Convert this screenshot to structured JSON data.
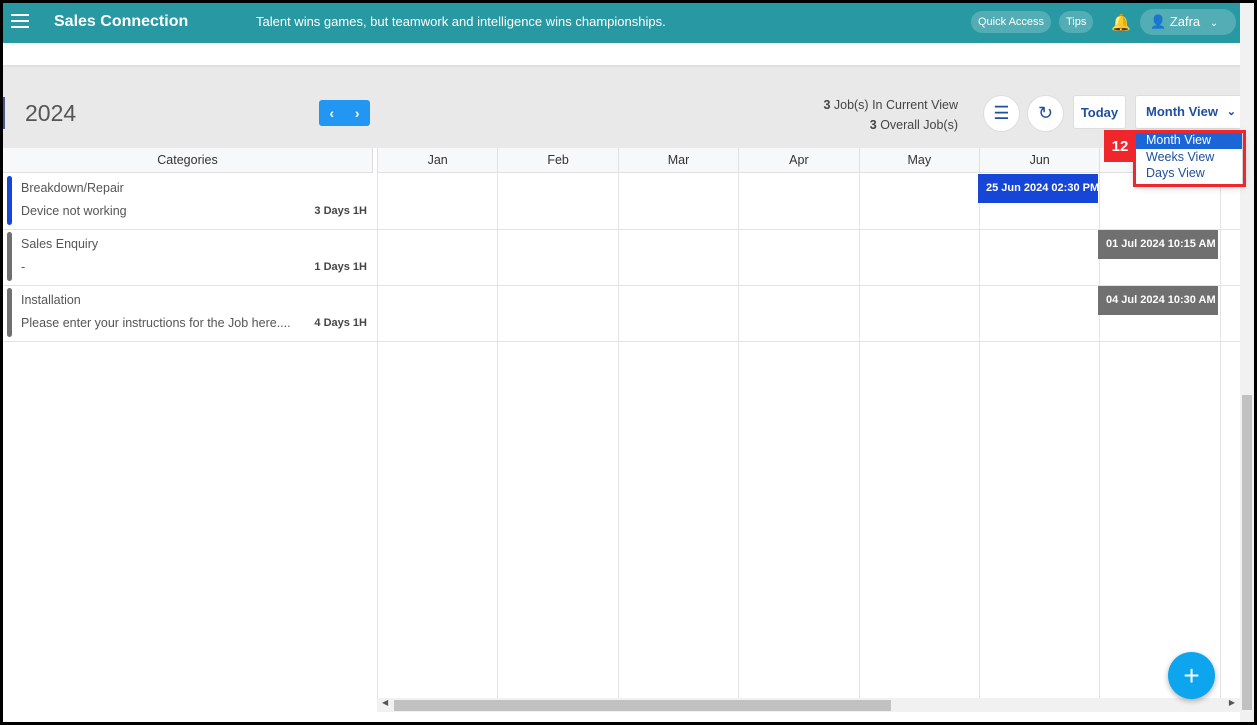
{
  "header": {
    "brand": "Sales Connection",
    "quote": "Talent wins games, but teamwork and intelligence wins championships.",
    "quick_access": "Quick Access",
    "tips": "Tips",
    "user": "Zafra",
    "color": "#2899a2"
  },
  "toolbar": {
    "year": "2024",
    "prev": "‹",
    "next": "›",
    "current_count": "3",
    "current_label": " Job(s) In Current View",
    "overall_count": "3",
    "overall_label": " Overall Job(s)",
    "today": "Today",
    "view": "Month View"
  },
  "view_dropdown": {
    "options": [
      "Month View",
      "Weeks View",
      "Days View"
    ],
    "selected": "Month View",
    "annotation": "12"
  },
  "grid": {
    "categories_header": "Categories",
    "months": [
      "Jan",
      "Feb",
      "Mar",
      "Apr",
      "May",
      "Jun",
      ""
    ]
  },
  "categories": [
    {
      "title": "Breakdown/Repair",
      "desc": "Device not working",
      "duration": "3 Days 1H",
      "color": "#1546d8"
    },
    {
      "title": "Sales Enquiry",
      "desc": "-",
      "duration": "1 Days 1H",
      "color": "#707070"
    },
    {
      "title": "Installation",
      "desc": "Please enter your instructions for the Job here....",
      "duration": "4 Days 1H",
      "color": "#707070"
    }
  ],
  "events": [
    {
      "label": "25 Jun 2024 02:30 PM",
      "color": "#1546d8"
    },
    {
      "label": "01 Jul 2024 10:15 AM",
      "color": "#707070"
    },
    {
      "label": "04 Jul 2024 10:30 AM",
      "color": "#707070"
    }
  ],
  "fab": "+"
}
